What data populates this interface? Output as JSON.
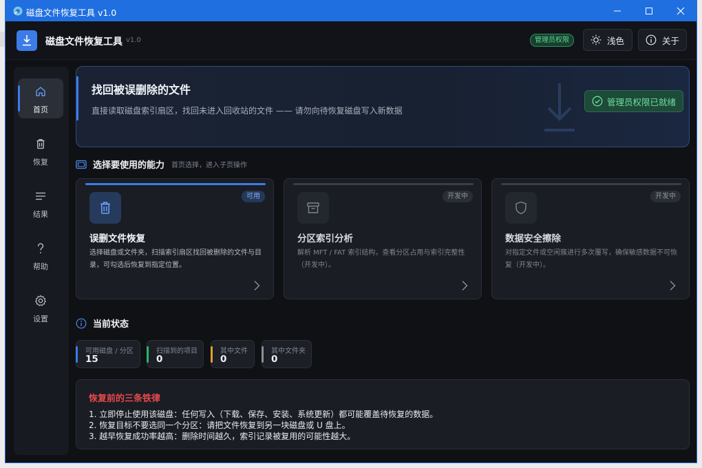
{
  "window": {
    "title": "磁盘文件恢复工具 v1.0"
  },
  "header": {
    "app_name": "磁盘文件恢复工具",
    "version": "v1.0",
    "admin_badge": "管理员权限",
    "theme_button": "浅色",
    "about_button": "关于"
  },
  "sidebar": {
    "items": [
      {
        "label": "首页",
        "icon": "home-icon",
        "active": true
      },
      {
        "label": "恢复",
        "icon": "trash-icon",
        "active": false
      },
      {
        "label": "结果",
        "icon": "list-icon",
        "active": false
      },
      {
        "label": "帮助",
        "icon": "question-icon",
        "active": false
      },
      {
        "label": "设置",
        "icon": "gear-icon",
        "active": false
      }
    ]
  },
  "hero": {
    "title": "找回被误删除的文件",
    "subtitle": "直接读取磁盘索引扇区，找回未进入回收站的文件 —— 请勿向待恢复磁盘写入新数据",
    "badge": "管理员权限已就绪"
  },
  "capabilities": {
    "title": "选择要使用的能力",
    "hint": "首页选择，进入子页操作",
    "cards": [
      {
        "title": "误删文件恢复",
        "tag": "可用",
        "icon": "trash-icon",
        "description": "选择磁盘或文件夹，扫描索引扇区找回被删除的文件与目录，可勾选后恢复到指定位置。"
      },
      {
        "title": "分区索引分析",
        "tag": "开发中",
        "icon": "archive-icon",
        "description": "解析 MFT / FAT 索引结构，查看分区占用与索引完整性（开发中）。"
      },
      {
        "title": "数据安全擦除",
        "tag": "开发中",
        "icon": "shield-icon",
        "description": "对指定文件或空闲簇进行多次覆写，确保敏感数据不可恢复（开发中）。"
      }
    ]
  },
  "status": {
    "title": "当前状态",
    "stats": [
      {
        "label": "可用磁盘 / 分区",
        "value": "15",
        "color": "#3d7be6"
      },
      {
        "label": "扫描到的项目",
        "value": "0",
        "color": "#2fb36d"
      },
      {
        "label": "其中文件",
        "value": "0",
        "color": "#e0a030"
      },
      {
        "label": "其中文件夹",
        "value": "0",
        "color": "#8a8f98"
      }
    ]
  },
  "rules": {
    "title": "恢复前的三条铁律",
    "items": [
      "1. 立即停止使用该磁盘：任何写入（下载、保存、安装、系统更新）都可能覆盖待恢复的数据。",
      "2. 恢复目标不要选同一个分区：请把文件恢复到另一块磁盘或 U 盘上。",
      "3. 越早恢复成功率越高：删除时间越久，索引记录被复用的可能性越大。"
    ]
  }
}
